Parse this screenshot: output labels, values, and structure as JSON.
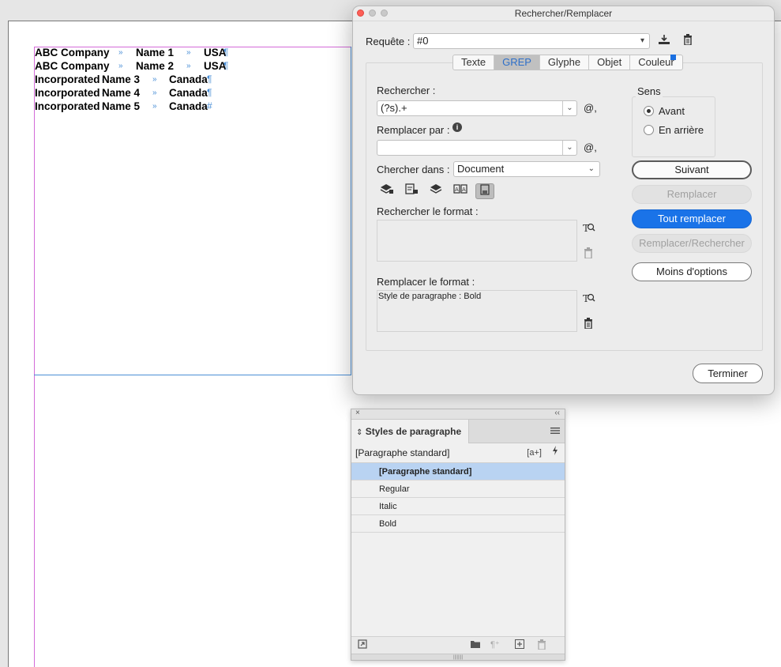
{
  "document": {
    "rows": [
      {
        "c1": "ABC Company",
        "c2": "Name 1",
        "c3": "USA"
      },
      {
        "c1": "ABC Company",
        "c2": "Name 2",
        "c3": "USA"
      },
      {
        "c1": "Incorporated",
        "c2": "Name 3",
        "c3": "Canada"
      },
      {
        "c1": "Incorporated",
        "c2": "Name 4",
        "c3": "Canada"
      },
      {
        "c1": "Incorporated",
        "c2": "Name 5",
        "c3": "Canada"
      }
    ],
    "tab_glyph": "»",
    "pilcrow": "¶",
    "end_glyph": "#",
    "dot_glyph": "·"
  },
  "dialog": {
    "title": "Rechercher/Remplacer",
    "query_label": "Requête :",
    "query_value": "#0",
    "tabs": [
      "Texte",
      "GREP",
      "Glyphe",
      "Objet",
      "Couleur"
    ],
    "active_tab": "GREP",
    "find_label": "Rechercher :",
    "find_value": "(?s).+",
    "replace_label": "Remplacer par :",
    "replace_value": "",
    "search_in_label": "Chercher dans :",
    "search_in_value": "Document",
    "find_format_label": "Rechercher le format :",
    "find_format_value": "",
    "replace_format_label": "Remplacer le format :",
    "replace_format_value": "Style de paragraphe : Bold",
    "direction": {
      "title": "Sens",
      "forward": "Avant",
      "backward": "En arrière",
      "selected": "forward"
    },
    "buttons": {
      "next": "Suivant",
      "replace": "Remplacer",
      "replace_all": "Tout remplacer",
      "replace_find": "Remplacer/Rechercher",
      "fewer_options": "Moins d'options",
      "done": "Terminer"
    },
    "special_char_glyph": "@,",
    "info_glyph": "i",
    "accent_color": "#1a73e8"
  },
  "styles_panel": {
    "title": "Styles de paragraphe",
    "current_style": "[Paragraphe standard]",
    "new_badge": "[a+]",
    "styles": [
      {
        "name": "[Paragraphe standard]",
        "selected": true
      },
      {
        "name": "Regular",
        "selected": false
      },
      {
        "name": "Italic",
        "selected": false
      },
      {
        "name": "Bold",
        "selected": false
      }
    ],
    "close_glyph": "×",
    "collapse_glyph": "‹‹",
    "sort_glyph": "⇕",
    "clear_overrides_glyph": "¶⁺"
  }
}
